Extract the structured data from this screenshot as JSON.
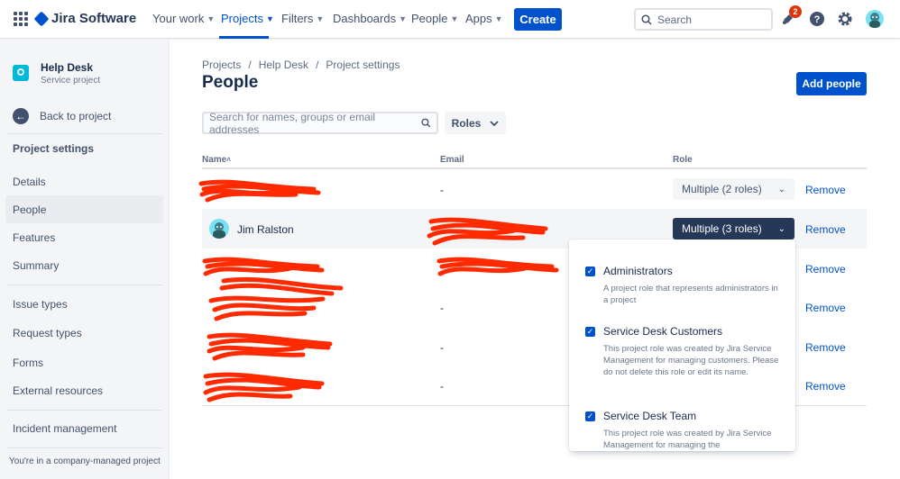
{
  "topnav": {
    "product": "Jira Software",
    "items": [
      {
        "label": "Your work",
        "chevron": true
      },
      {
        "label": "Projects",
        "chevron": true,
        "active": true
      },
      {
        "label": "Filters",
        "chevron": true
      },
      {
        "label": "Dashboards",
        "chevron": true
      },
      {
        "label": "People",
        "chevron": true
      },
      {
        "label": "Apps",
        "chevron": true
      }
    ],
    "create_label": "Create",
    "search_placeholder": "Search",
    "notification_count": "2",
    "icons": [
      "app-switcher-icon",
      "jira-logo-icon",
      "search-icon",
      "notification-icon",
      "help-icon",
      "settings-icon",
      "avatar"
    ]
  },
  "sidebar": {
    "project_name": "Help Desk",
    "project_type": "Service project",
    "back_label": "Back to project",
    "heading": "Project settings",
    "items": [
      "Details",
      "People",
      "Features",
      "Summary",
      "Issue types",
      "Request types",
      "Forms",
      "External resources",
      "Incident management"
    ],
    "active_item": "People",
    "footer": "You're in a company-managed project"
  },
  "main": {
    "breadcrumb": [
      "Projects",
      "Help Desk",
      "Project settings"
    ],
    "breadcrumb_separator": "/",
    "title": "People",
    "add_people_label": "Add people",
    "filter_placeholder": "Search for names, groups or email addresses",
    "roles_label": "Roles",
    "columns": {
      "name": "Name",
      "name_sort": "˄",
      "email": "Email",
      "role": "Role"
    },
    "rows": [
      {
        "name": "",
        "email": "-",
        "role": "Multiple (2 roles)",
        "remove": "Remove"
      },
      {
        "name": "Jim Ralston",
        "email": "",
        "role": "Multiple (3 roles)",
        "remove": "Remove"
      },
      {
        "name": "",
        "email": "",
        "role": "",
        "remove": "Remove"
      },
      {
        "name": "",
        "email": "-",
        "role": "",
        "remove": "Remove"
      },
      {
        "name": "",
        "email": "-",
        "role": "",
        "remove": "Remove"
      },
      {
        "name": "",
        "email": "-",
        "role": "",
        "remove": "Remove"
      }
    ]
  },
  "roles_dropdown": {
    "options": [
      {
        "title": "Administrators",
        "checked": true,
        "description": "A project role that represents administrators in a project"
      },
      {
        "title": "Service Desk Customers",
        "checked": true,
        "description": "This project role was created by Jira Service Management for managing customers. Please do not delete this role or edit its name."
      },
      {
        "title": "Service Desk Team",
        "checked": true,
        "description": "This project role was created by Jira Service Management for managing the"
      }
    ]
  },
  "colors": {
    "accent": "#0052CC",
    "redaction": "#FF2A00",
    "dark_button": "#253858"
  }
}
